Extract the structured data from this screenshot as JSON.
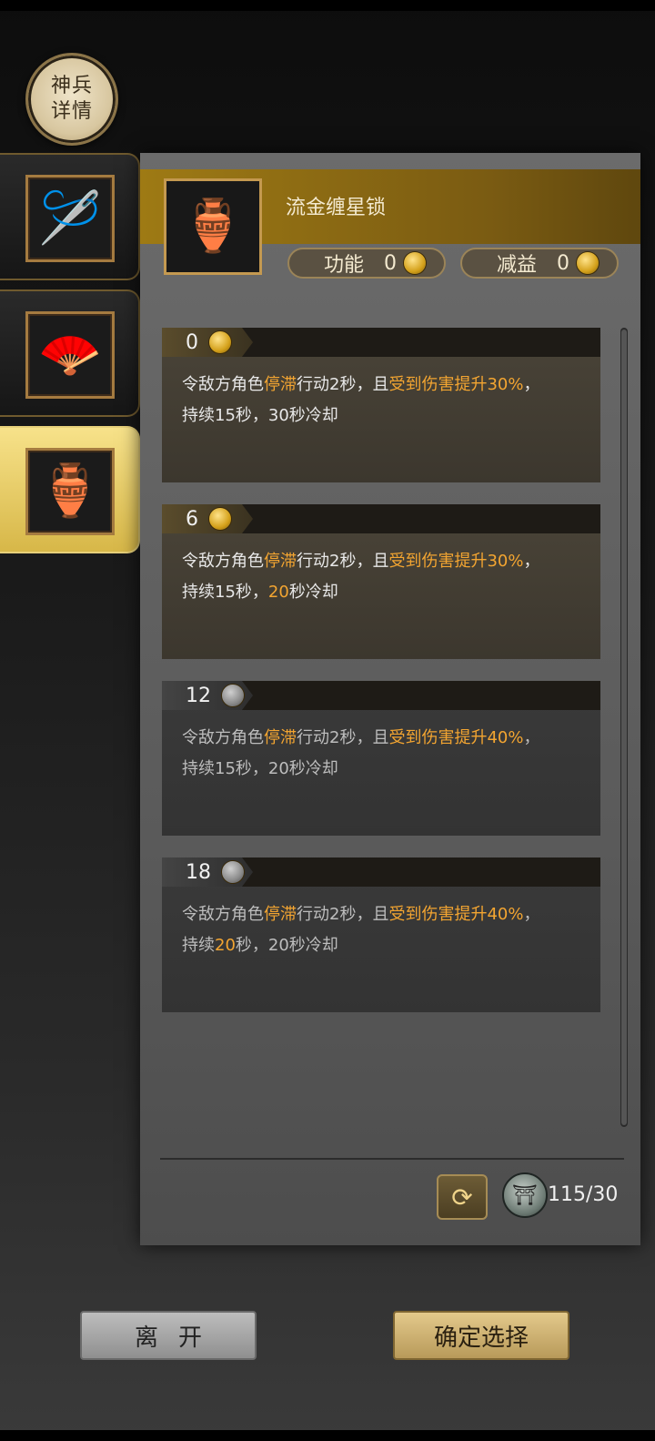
{
  "badge": {
    "line1": "神兵",
    "line2": "详情"
  },
  "tabs": [
    {
      "name": "hairpins",
      "glyph": "🪡",
      "active": false
    },
    {
      "name": "fan",
      "glyph": "🪭",
      "active": false
    },
    {
      "name": "gourd-chain",
      "glyph": "🏺",
      "active": true
    }
  ],
  "item": {
    "title": "流金缠星锁",
    "stats": [
      {
        "label": "功能",
        "value": "0"
      },
      {
        "label": "减益",
        "value": "0"
      }
    ]
  },
  "levels": [
    {
      "level": "0",
      "locked": false,
      "parts": [
        [
          "令敌方角色",
          ""
        ],
        [
          "停滞",
          "hl"
        ],
        [
          "行动2秒，且",
          ""
        ],
        [
          "受到伤害提升30%",
          "hl"
        ],
        [
          "，",
          ""
        ]
      ],
      "line2": [
        [
          "持续15秒，30秒冷却",
          ""
        ]
      ]
    },
    {
      "level": "6",
      "locked": false,
      "parts": [
        [
          "令敌方角色",
          ""
        ],
        [
          "停滞",
          "hl"
        ],
        [
          "行动2秒，且",
          ""
        ],
        [
          "受到伤害提升30%",
          "hl"
        ],
        [
          "，",
          ""
        ]
      ],
      "line2": [
        [
          "持续15秒，",
          ""
        ],
        [
          "20",
          "hl"
        ],
        [
          "秒冷却",
          ""
        ]
      ]
    },
    {
      "level": "12",
      "locked": true,
      "parts": [
        [
          "令敌方角色",
          ""
        ],
        [
          "停滞",
          "hl"
        ],
        [
          "行动2秒，且",
          ""
        ],
        [
          "受到伤害提升40%",
          "hl"
        ],
        [
          "，",
          ""
        ]
      ],
      "line2": [
        [
          "持续15秒，20秒冷却",
          ""
        ]
      ]
    },
    {
      "level": "18",
      "locked": true,
      "parts": [
        [
          "令敌方角色",
          ""
        ],
        [
          "停滞",
          "hl"
        ],
        [
          "行动2秒，且",
          ""
        ],
        [
          "受到伤害提升40%",
          "hl"
        ],
        [
          "，",
          ""
        ]
      ],
      "line2": [
        [
          "持续",
          ""
        ],
        [
          "20",
          "hl"
        ],
        [
          "秒，20秒冷却",
          ""
        ]
      ]
    }
  ],
  "currency": {
    "value": "115/30"
  },
  "buttons": {
    "leave": "离开",
    "confirm": "确定选择"
  },
  "colors": {
    "highlight": "#f3a531",
    "gold": "#9e7a14"
  }
}
